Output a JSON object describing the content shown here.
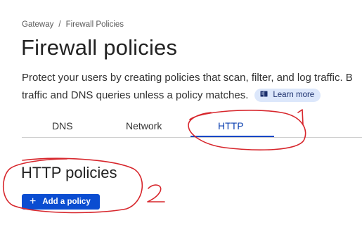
{
  "breadcrumb": {
    "items": [
      "Gateway",
      "Firewall Policies"
    ],
    "separator": "/"
  },
  "page_title": "Firewall policies",
  "description": {
    "line1": "Protect your users by creating policies that scan, filter, and log traffic. B",
    "line2": "traffic and DNS queries unless a policy matches.",
    "learn_more_label": "Learn more",
    "learn_more_icon": "book-icon"
  },
  "tabs": [
    {
      "label": "DNS",
      "active": false
    },
    {
      "label": "Network",
      "active": false
    },
    {
      "label": "HTTP",
      "active": true
    }
  ],
  "section": {
    "title": "HTTP policies",
    "add_button_label": "Add a policy",
    "add_button_icon": "plus-icon"
  },
  "annotations": {
    "color": "#d7262c",
    "marks": [
      "1",
      "2"
    ]
  },
  "colors": {
    "accent": "#0b4dd1",
    "tab_active": "#0a3fb0",
    "learn_more_bg": "#dce7fb"
  }
}
